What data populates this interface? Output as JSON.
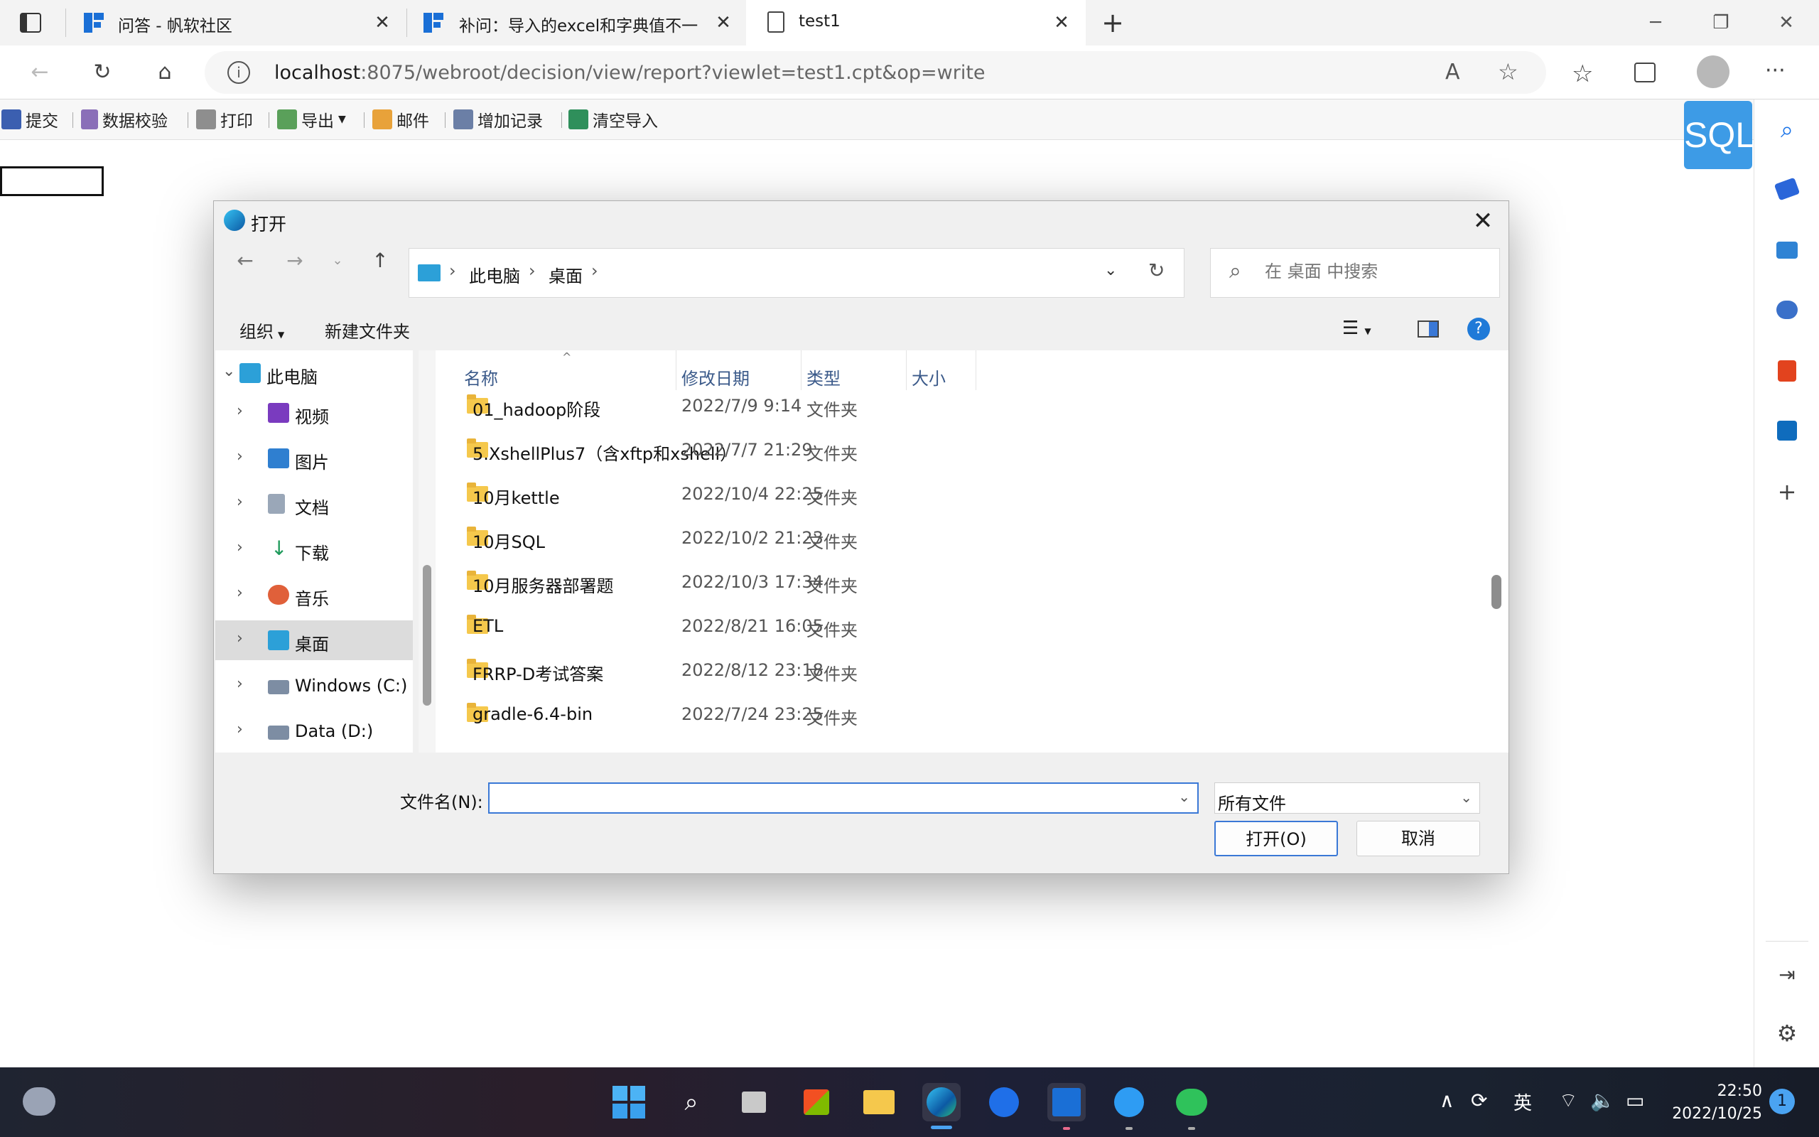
{
  "browser": {
    "tabs": [
      {
        "title": "问答 - 帆软社区"
      },
      {
        "title": "补问：导入的excel和字典值不一"
      },
      {
        "title": "test1"
      }
    ],
    "url_host": "localhost",
    "url_rest": ":8075/webroot/decision/view/report?viewlet=test1.cpt&op=write"
  },
  "report_toolbar": {
    "items": [
      "提交",
      "数据校验",
      "打印",
      "导出",
      "邮件",
      "增加记录",
      "清空导入"
    ]
  },
  "sql_badge": "SQL",
  "dialog": {
    "title": "打开",
    "breadcrumb": [
      "此电脑",
      "桌面"
    ],
    "search_placeholder": "在 桌面 中搜索",
    "cmd_organize": "组织",
    "cmd_new_folder": "新建文件夹",
    "nav_items": [
      {
        "label": "此电脑"
      },
      {
        "label": "视频"
      },
      {
        "label": "图片"
      },
      {
        "label": "文档"
      },
      {
        "label": "下载"
      },
      {
        "label": "音乐"
      },
      {
        "label": "桌面"
      },
      {
        "label": "Windows (C:)"
      },
      {
        "label": "Data (D:)"
      }
    ],
    "columns": [
      "名称",
      "修改日期",
      "类型",
      "大小"
    ],
    "files": [
      {
        "name": "01_hadoop阶段",
        "date": "2022/7/9 9:14",
        "type": "文件夹"
      },
      {
        "name": "5.XshellPlus7（含xftp和xshell）",
        "date": "2022/7/7 21:29",
        "type": "文件夹"
      },
      {
        "name": "10月kettle",
        "date": "2022/10/4 22:25",
        "type": "文件夹"
      },
      {
        "name": "10月SQL",
        "date": "2022/10/2 21:23",
        "type": "文件夹"
      },
      {
        "name": "10月服务器部署题",
        "date": "2022/10/3 17:34",
        "type": "文件夹"
      },
      {
        "name": "ETL",
        "date": "2022/8/21 16:05",
        "type": "文件夹"
      },
      {
        "name": "FRRP-D考试答案",
        "date": "2022/8/12 23:18",
        "type": "文件夹"
      },
      {
        "name": "gradle-6.4-bin",
        "date": "2022/7/24 23:25",
        "type": "文件夹"
      }
    ],
    "filename_label": "文件名(N):",
    "filename_value": "",
    "filetype_value": "所有文件",
    "open_label": "打开(O)",
    "cancel_label": "取消"
  },
  "taskbar": {
    "time": "22:50",
    "date": "2022/10/25",
    "ime": "英",
    "notifications": "1"
  },
  "colors": {
    "accent": "#3a78d6",
    "sql_badge": "#3d9be6",
    "taskbar": "#1d2131"
  }
}
